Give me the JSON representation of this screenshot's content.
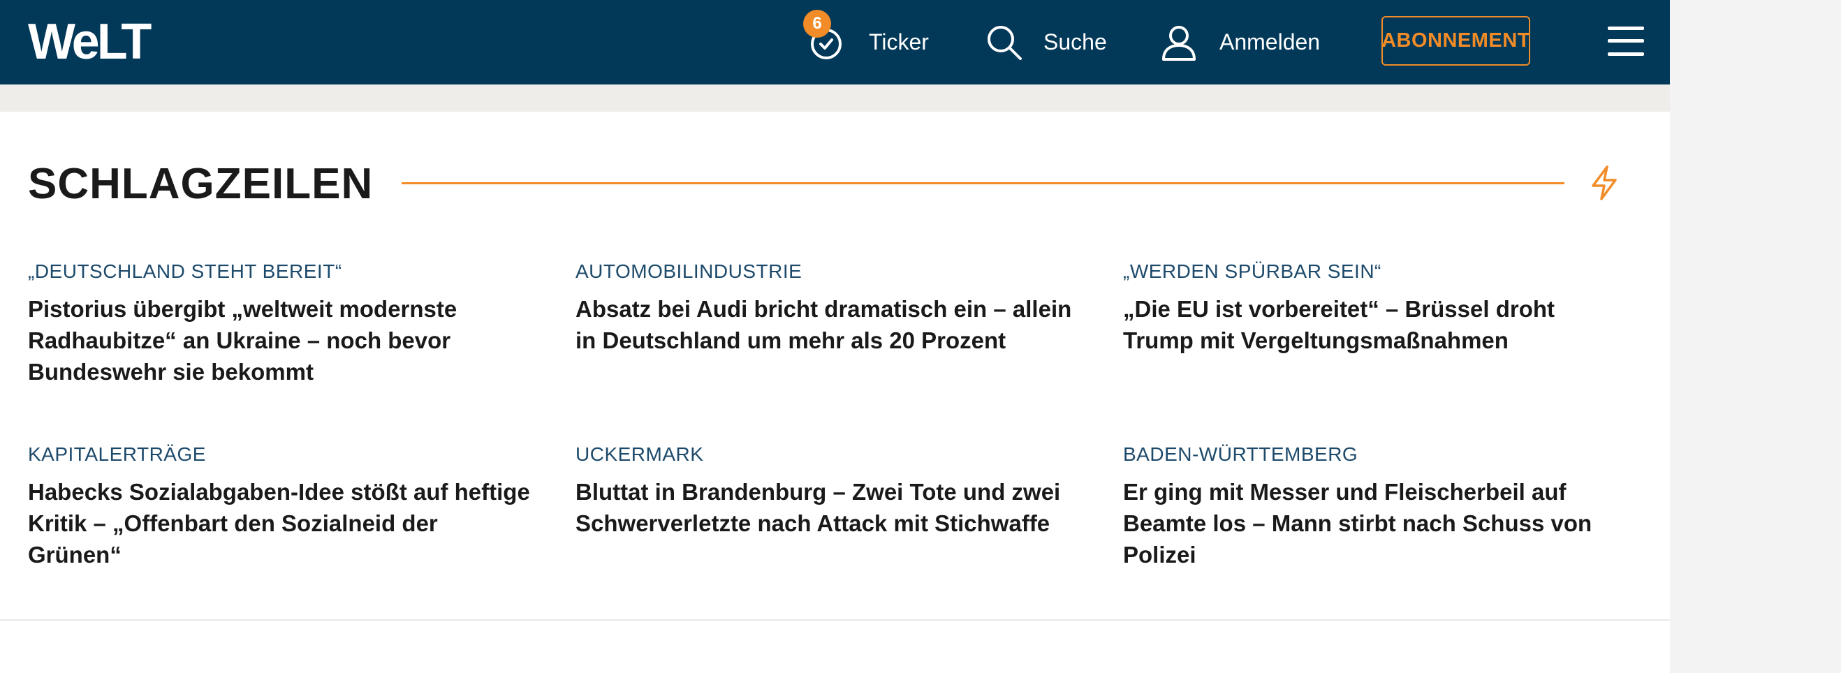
{
  "header": {
    "logo": "WeLT",
    "ticker": {
      "badge": "6",
      "label": "Ticker"
    },
    "search_label": "Suche",
    "login_label": "Anmelden",
    "subscribe_label": "ABONNEMENT"
  },
  "colors": {
    "header_bg": "#023858",
    "accent": "#f28c28"
  },
  "section": {
    "title": "SCHLAGZEILEN"
  },
  "articles": [
    {
      "kicker": "„DEUTSCHLAND STEHT BEREIT“",
      "headline": "Pistorius übergibt „weltweit modernste Radhaubitze“ an Ukraine – noch bevor Bundeswehr sie bekommt"
    },
    {
      "kicker": "AUTOMOBILINDUSTRIE",
      "headline": "Absatz bei Audi bricht dramatisch ein – allein in Deutschland um mehr als 20 Prozent"
    },
    {
      "kicker": "„WERDEN SPÜRBAR SEIN“",
      "headline": "„Die EU ist vorbereitet“ – Brüssel droht Trump mit Vergeltungsmaßnahmen"
    },
    {
      "kicker": "KAPITALERTRÄGE",
      "headline": "Habecks Sozialabgaben-Idee stößt auf heftige Kritik – „Offenbart den Sozialneid der Grünen“"
    },
    {
      "kicker": "UCKERMARK",
      "headline": "Bluttat in Brandenburg – Zwei Tote und zwei Schwerverletzte nach Attack mit Stichwaffe"
    },
    {
      "kicker": "BADEN-WÜRTTEMBERG",
      "headline": "Er ging mit Messer und Fleischerbeil auf Beamte los – Mann stirbt nach Schuss von Polizei"
    }
  ]
}
